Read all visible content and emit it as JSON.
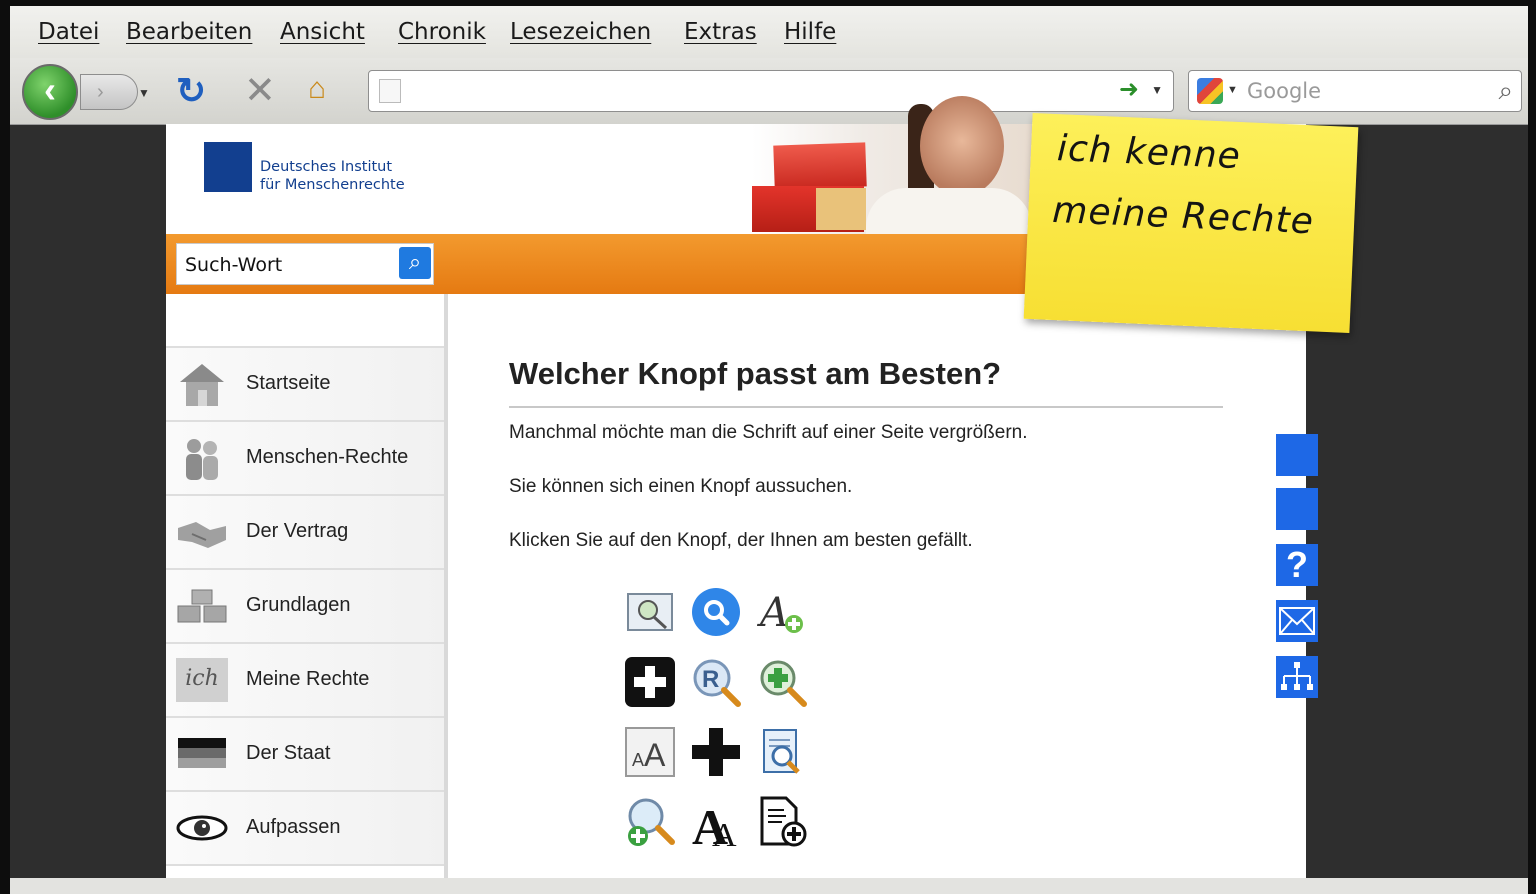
{
  "menu": [
    "Datei",
    "Bearbeiten",
    "Ansicht",
    "Chronik",
    "Lesezeichen",
    "Extras",
    "Hilfe"
  ],
  "toolbar": {
    "search_placeholder": "Google",
    "icons": [
      "back-icon",
      "forward-icon",
      "reload-icon",
      "stop-icon",
      "home-icon",
      "go-icon",
      "search-engine-icon",
      "magnifier-icon"
    ]
  },
  "header": {
    "org_name_line1": "Deutsches Institut",
    "org_name_line2": "für Menschenrechte",
    "postit_line1": "ich kenne",
    "postit_line2": "meine Rechte"
  },
  "search": {
    "value": "Such-Wort"
  },
  "sidebar": {
    "items": [
      {
        "label": "Startseite",
        "icon": "house-icon"
      },
      {
        "label": "Menschen-Rechte",
        "icon": "people-icon"
      },
      {
        "label": "Der Vertrag",
        "icon": "handshake-icon"
      },
      {
        "label": "Grundlagen",
        "icon": "building-blocks-icon"
      },
      {
        "label": "Meine Rechte",
        "icon": "ich-icon",
        "icon_text": "ich"
      },
      {
        "label": "Der Staat",
        "icon": "flag-icon"
      },
      {
        "label": "Aufpassen",
        "icon": "eye-icon"
      }
    ]
  },
  "main": {
    "title": "Welcher Knopf passt am Besten?",
    "paragraphs": [
      "Manchmal möchte man die Schrift auf einer Seite vergrößern.",
      "Sie können sich einen Knopf aussuchen.",
      "Klicken Sie auf den Knopf, der Ihnen am besten gefällt."
    ],
    "zoom_buttons": [
      "image-zoom-icon",
      "blue-magnifier-icon",
      "font-plus-icon",
      "black-plus-box-icon",
      "magnifier-r-icon",
      "green-plus-magnifier-icon",
      "text-size-aa-icon",
      "black-plus-icon",
      "document-magnifier-icon",
      "magnifier-plus-icon",
      "font-a-icon",
      "document-plus-icon"
    ]
  },
  "side_tools": [
    "blank-tool-1",
    "blank-tool-2",
    "help-icon",
    "mail-icon",
    "sitemap-icon"
  ],
  "colors": {
    "accent_orange": "#e57a12",
    "tool_blue": "#1e68e6",
    "logo_blue": "#123f8f"
  }
}
